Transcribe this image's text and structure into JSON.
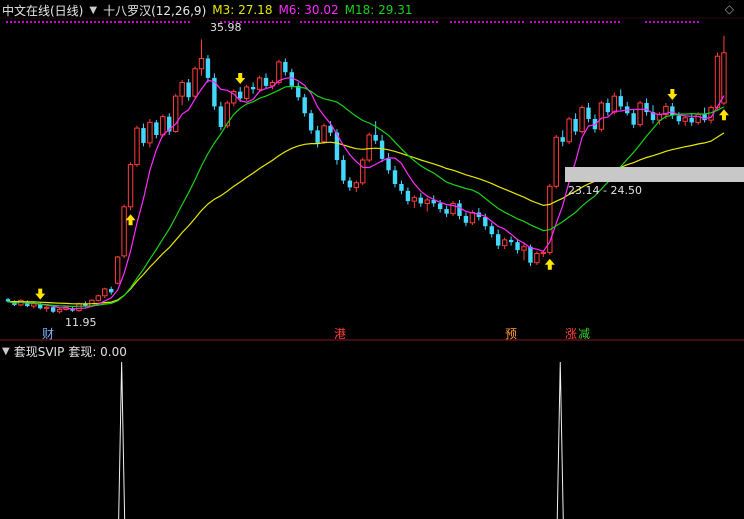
{
  "header": {
    "title": "中文在线(日线)",
    "indicator_name": "十八罗汉(12,26,9)",
    "ma_items": [
      {
        "label": "M3: 27.18",
        "color": "#e8e800"
      },
      {
        "label": "M6: 30.02",
        "color": "#ff2bff"
      },
      {
        "label": "M18: 29.31",
        "color": "#19d219"
      }
    ]
  },
  "sub_panel": {
    "title": "套现SVIP",
    "value_label": "套现: 0.00"
  },
  "chart_data": {
    "type": "candlestick",
    "price_range": [
      10.5,
      37.5
    ],
    "annotations": {
      "high_label": "35.98",
      "low_label": "11.95",
      "range_label": "23.14 - 24.50"
    },
    "markers": [
      {
        "text": "财",
        "color": "#7fb3ff"
      },
      {
        "text": "港",
        "color": "#ff4040"
      },
      {
        "text": "预",
        "color": "#ff9a40"
      },
      {
        "text": "涨",
        "color": "#ff4040"
      },
      {
        "text": "减",
        "color": "#30d030"
      }
    ],
    "candles": [
      [
        13.2,
        13.3,
        12.9,
        13.0
      ],
      [
        13.0,
        13.1,
        12.6,
        12.7
      ],
      [
        12.7,
        13.2,
        12.6,
        13.1
      ],
      [
        13.0,
        13.1,
        12.5,
        12.6
      ],
      [
        12.6,
        12.9,
        12.4,
        12.8
      ],
      [
        12.8,
        12.9,
        12.3,
        12.4
      ],
      [
        12.4,
        12.6,
        12.1,
        12.5
      ],
      [
        12.5,
        12.6,
        12.0,
        12.1
      ],
      [
        12.1,
        12.4,
        11.95,
        12.3
      ],
      [
        12.3,
        12.6,
        12.2,
        12.5
      ],
      [
        12.4,
        12.5,
        12.1,
        12.2
      ],
      [
        12.2,
        12.9,
        12.1,
        12.8
      ],
      [
        12.8,
        13.0,
        12.5,
        12.6
      ],
      [
        12.6,
        13.2,
        12.5,
        13.1
      ],
      [
        13.1,
        13.6,
        13.0,
        13.5
      ],
      [
        13.5,
        14.2,
        13.3,
        14.1
      ],
      [
        14.1,
        14.3,
        13.6,
        13.8
      ],
      [
        14.6,
        17.0,
        14.5,
        16.9
      ],
      [
        17.0,
        21.5,
        16.8,
        21.3
      ],
      [
        21.3,
        25.2,
        21.0,
        25.0
      ],
      [
        25.0,
        28.4,
        24.8,
        28.2
      ],
      [
        28.2,
        28.6,
        26.6,
        26.9
      ],
      [
        26.9,
        29.0,
        26.5,
        28.7
      ],
      [
        28.7,
        28.9,
        27.3,
        27.6
      ],
      [
        27.6,
        29.4,
        27.4,
        29.2
      ],
      [
        29.2,
        29.5,
        27.6,
        27.9
      ],
      [
        27.9,
        31.2,
        27.8,
        31.0
      ],
      [
        31.0,
        32.4,
        30.2,
        32.2
      ],
      [
        32.2,
        32.5,
        30.6,
        30.9
      ],
      [
        31.0,
        33.6,
        30.8,
        33.4
      ],
      [
        33.4,
        35.98,
        32.8,
        34.3
      ],
      [
        34.3,
        34.6,
        32.2,
        32.6
      ],
      [
        32.6,
        33.0,
        29.8,
        30.1
      ],
      [
        30.1,
        30.5,
        28.0,
        28.3
      ],
      [
        28.4,
        30.6,
        28.2,
        30.4
      ],
      [
        30.4,
        31.6,
        30.1,
        31.4
      ],
      [
        31.4,
        31.8,
        30.5,
        30.8
      ],
      [
        30.8,
        32.0,
        30.6,
        31.8
      ],
      [
        31.8,
        32.2,
        31.2,
        31.6
      ],
      [
        31.6,
        32.8,
        31.4,
        32.6
      ],
      [
        32.6,
        33.0,
        31.6,
        31.9
      ],
      [
        31.9,
        32.4,
        31.6,
        32.2
      ],
      [
        32.2,
        34.2,
        32.0,
        34.0
      ],
      [
        34.0,
        34.3,
        32.8,
        33.1
      ],
      [
        33.1,
        33.4,
        31.6,
        31.9
      ],
      [
        31.9,
        32.2,
        30.6,
        30.9
      ],
      [
        30.9,
        31.2,
        29.2,
        29.5
      ],
      [
        29.5,
        29.8,
        27.7,
        28.0
      ],
      [
        28.0,
        28.4,
        26.5,
        26.9
      ],
      [
        27.0,
        28.6,
        26.8,
        28.4
      ],
      [
        28.4,
        28.8,
        27.5,
        27.8
      ],
      [
        27.8,
        28.1,
        25.0,
        25.4
      ],
      [
        25.4,
        25.8,
        23.3,
        23.6
      ],
      [
        23.6,
        23.9,
        22.7,
        23.0
      ],
      [
        23.0,
        23.6,
        22.6,
        23.4
      ],
      [
        23.4,
        25.6,
        23.2,
        25.4
      ],
      [
        25.4,
        27.8,
        25.2,
        27.6
      ],
      [
        27.6,
        28.8,
        26.8,
        27.1
      ],
      [
        27.1,
        27.6,
        25.2,
        25.5
      ],
      [
        25.5,
        26.0,
        24.2,
        24.5
      ],
      [
        24.5,
        24.9,
        23.0,
        23.3
      ],
      [
        23.3,
        23.6,
        22.4,
        22.7
      ],
      [
        22.7,
        23.0,
        21.5,
        21.8
      ],
      [
        21.8,
        22.3,
        21.2,
        22.1
      ],
      [
        22.1,
        22.5,
        21.3,
        21.6
      ],
      [
        21.6,
        22.1,
        20.9,
        21.9
      ],
      [
        21.9,
        22.3,
        21.3,
        21.6
      ],
      [
        21.6,
        21.9,
        20.8,
        21.1
      ],
      [
        21.1,
        21.4,
        20.4,
        20.7
      ],
      [
        20.7,
        21.8,
        20.5,
        21.6
      ],
      [
        21.6,
        21.9,
        20.2,
        20.5
      ],
      [
        20.5,
        20.8,
        19.6,
        19.9
      ],
      [
        19.9,
        21.0,
        19.7,
        20.8
      ],
      [
        20.8,
        21.2,
        20.1,
        20.4
      ],
      [
        20.4,
        20.7,
        19.3,
        19.6
      ],
      [
        19.6,
        19.9,
        18.6,
        18.9
      ],
      [
        18.9,
        19.3,
        17.6,
        17.9
      ],
      [
        17.9,
        18.6,
        17.6,
        18.4
      ],
      [
        18.4,
        18.7,
        17.9,
        18.2
      ],
      [
        18.2,
        18.5,
        17.2,
        17.5
      ],
      [
        17.5,
        18.2,
        16.6,
        17.8
      ],
      [
        17.8,
        18.0,
        16.1,
        16.4
      ],
      [
        16.4,
        17.4,
        16.2,
        17.2
      ],
      [
        17.2,
        17.5,
        16.9,
        17.3
      ],
      [
        17.3,
        23.3,
        17.1,
        23.1
      ],
      [
        23.1,
        27.6,
        22.9,
        27.4
      ],
      [
        27.4,
        28.0,
        26.6,
        27.0
      ],
      [
        27.0,
        29.2,
        26.8,
        29.0
      ],
      [
        29.0,
        29.5,
        27.6,
        27.9
      ],
      [
        27.9,
        30.2,
        27.7,
        30.0
      ],
      [
        30.0,
        30.4,
        28.7,
        29.0
      ],
      [
        29.0,
        29.4,
        27.8,
        28.1
      ],
      [
        28.1,
        30.6,
        27.9,
        30.4
      ],
      [
        30.4,
        30.8,
        29.3,
        29.6
      ],
      [
        29.6,
        31.3,
        29.4,
        31.0
      ],
      [
        31.0,
        31.6,
        29.8,
        30.1
      ],
      [
        30.1,
        30.5,
        29.3,
        29.5
      ],
      [
        29.5,
        29.8,
        28.2,
        28.5
      ],
      [
        28.5,
        30.6,
        28.3,
        30.4
      ],
      [
        30.4,
        30.8,
        29.3,
        29.6
      ],
      [
        29.6,
        30.2,
        28.6,
        28.9
      ],
      [
        28.9,
        29.6,
        28.5,
        29.4
      ],
      [
        29.4,
        30.4,
        29.0,
        30.1
      ],
      [
        30.1,
        30.4,
        29.0,
        29.3
      ],
      [
        29.3,
        29.6,
        28.5,
        28.8
      ],
      [
        28.8,
        29.3,
        28.4,
        29.1
      ],
      [
        29.1,
        29.4,
        28.4,
        28.7
      ],
      [
        28.7,
        29.6,
        28.5,
        29.4
      ],
      [
        29.4,
        30.0,
        28.7,
        28.9
      ],
      [
        28.9,
        30.2,
        28.6,
        30.0
      ],
      [
        30.0,
        34.8,
        29.8,
        34.5
      ],
      [
        30.4,
        36.3,
        30.2,
        34.8
      ]
    ],
    "arrows": [
      {
        "index": 5,
        "dir": "down"
      },
      {
        "index": 19,
        "dir": "up"
      },
      {
        "index": 36,
        "dir": "down"
      },
      {
        "index": 84,
        "dir": "up"
      },
      {
        "index": 103,
        "dir": "down"
      },
      {
        "index": 111,
        "dir": "up"
      }
    ],
    "spikes": [
      17,
      85
    ]
  }
}
